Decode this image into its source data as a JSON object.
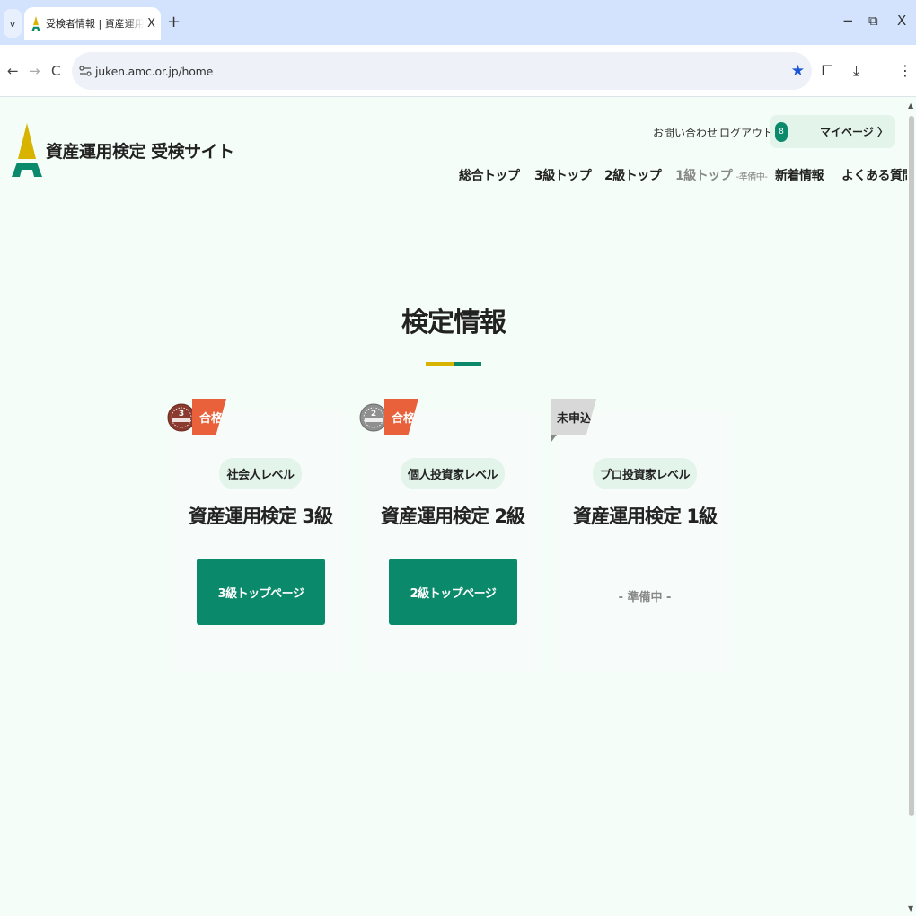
{
  "browser": {
    "tab_menu_label": "v",
    "tab_title": "受検者情報 | 資産運用検定 受検サイト",
    "tab_close": "X",
    "new_tab": "+",
    "minimize": "−",
    "restore": "⧉",
    "close": "X",
    "back": "←",
    "forward": "→",
    "reload": "C",
    "url": "juken.amc.or.jp/home",
    "star": "★",
    "extensions": "⧠",
    "download": "⤓",
    "menu": "⋮"
  },
  "header": {
    "site_name": "資産運用検定 受検サイト",
    "contact": "お問い合わせ",
    "logout": "ログアウト",
    "mypage": "マイページ 〉",
    "mypage_avatar": "8"
  },
  "nav": [
    {
      "label": "総合トップ",
      "sub": ""
    },
    {
      "label": "3級トップ",
      "sub": ""
    },
    {
      "label": "2級トップ",
      "sub": ""
    },
    {
      "label": "1級トップ",
      "sub": "-準備中-"
    },
    {
      "label": "新着情報",
      "sub": ""
    },
    {
      "label": "よくある質問",
      "sub": ""
    }
  ],
  "section": {
    "title": "検定情報"
  },
  "cards": [
    {
      "status": "合格",
      "level": "社会人レベル",
      "title": "資産運用検定 3級",
      "button": "3級トップページ",
      "medal_color": "#8a3a2e",
      "medal_text": "3"
    },
    {
      "status": "合格",
      "level": "個人投資家レベル",
      "title": "資産運用検定 2級",
      "button": "2級トップページ",
      "medal_color": "#8f8f8f",
      "medal_text": "2"
    },
    {
      "status": "未申込",
      "level": "プロ投資家レベル",
      "title": "資産運用検定 1級",
      "note": "- 準備中 -"
    }
  ],
  "colors": {
    "accent_green": "#0b8a6b",
    "accent_yellow": "#d8b400",
    "pass_orange": "#e8613a",
    "page_bg": "#f4fdf8"
  }
}
